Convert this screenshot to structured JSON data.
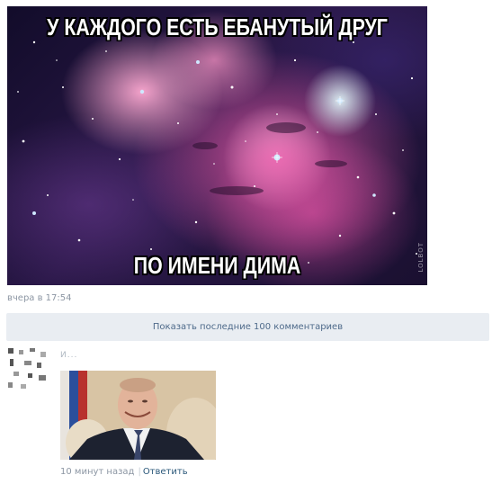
{
  "post": {
    "meme_top_text": "У КАЖДОГО ЕСТЬ ЕБАНУТЫЙ ДРУГ",
    "meme_bottom_text": "ПО ИМЕНИ ДИМА",
    "watermark": "LOLBOT",
    "timestamp": "вчера в 17:54"
  },
  "comments_toggle": {
    "label": "Показать последние 100 комментариев"
  },
  "comment": {
    "author": "И...",
    "time": "10 минут назад",
    "separator": "|",
    "reply_label": "Ответить"
  },
  "colors": {
    "link": "#2b587a",
    "meta": "#8c96a3",
    "button_bg": "#e9edf2"
  }
}
